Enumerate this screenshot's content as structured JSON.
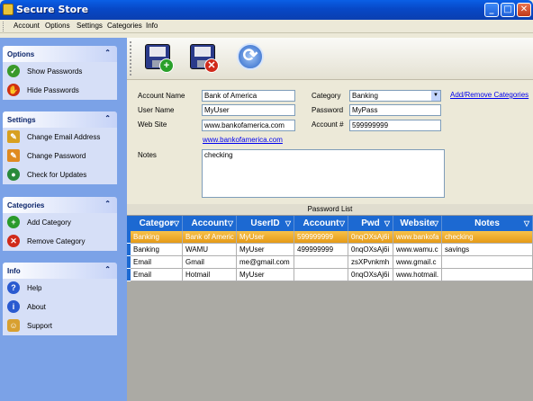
{
  "window": {
    "title": "Secure Store",
    "min": "_",
    "max": "□",
    "close": "✕"
  },
  "menu": [
    "Account",
    "Options",
    "Settings",
    "Categories",
    "Info"
  ],
  "sidebar": {
    "panels": [
      {
        "title": "Options",
        "items": [
          "Show Passwords",
          "Hide Passwords"
        ]
      },
      {
        "title": "Settings",
        "items": [
          "Change Email Address",
          "Change Password",
          "Check for Updates"
        ]
      },
      {
        "title": "Categories",
        "items": [
          "Add Category",
          "Remove Category"
        ]
      },
      {
        "title": "Info",
        "items": [
          "Help",
          "About",
          "Support"
        ]
      }
    ],
    "chevron": "⌃"
  },
  "toolbar": {
    "add_icon": "save-add-icon",
    "delete_icon": "save-delete-icon",
    "refresh_icon": "refresh-icon"
  },
  "form": {
    "account_name_label": "Account Name",
    "account_name": "Bank of America",
    "user_name_label": "User Name",
    "user_name": "MyUser",
    "web_site_label": "Web Site",
    "web_site": "www.bankofamerica.com",
    "web_link": "www.bankofamerica.com",
    "category_label": "Category",
    "category": "Banking",
    "password_label": "Password",
    "password": "MyPass",
    "account_num_label": "Account #",
    "account_num": "599999999",
    "add_remove_link": "Add/Remove Categories",
    "notes_label": "Notes",
    "notes": "checking"
  },
  "grid": {
    "caption": "Password List",
    "columns": [
      "Categor",
      "Account",
      "UserID",
      "Account",
      "Pwd",
      "Website",
      "Notes"
    ],
    "rows": [
      [
        "Banking",
        "Bank of Americ",
        "MyUser",
        "599999999",
        "0nqOXsAj6i",
        "www.bankofa",
        "checking"
      ],
      [
        "Banking",
        "WAMU",
        "MyUser",
        "499999999",
        "0nqOXsAj6i",
        "www.wamu.c",
        "savings"
      ],
      [
        "Email",
        "Gmail",
        "me@gmail.com",
        "",
        "zsXPvnkmh",
        "www.gmail.c",
        ""
      ],
      [
        "Email",
        "Hotmail",
        "MyUser",
        "",
        "0nqOXsAj6i",
        "www.hotmail.",
        ""
      ]
    ]
  },
  "colors": {
    "accent": "#1c69d2",
    "selected_row": "#e69a17",
    "sidebar": "#7ba2e7"
  }
}
